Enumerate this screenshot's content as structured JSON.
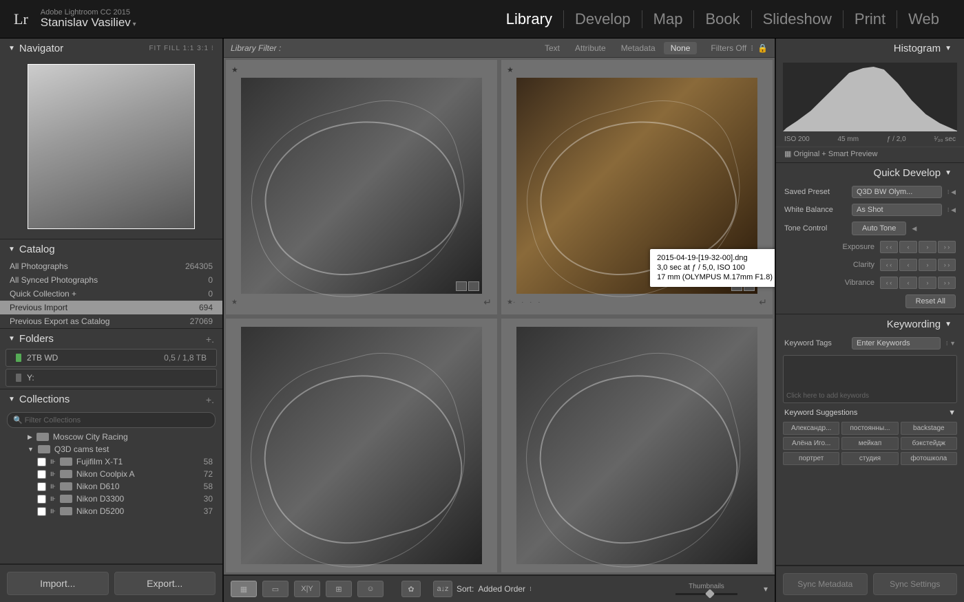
{
  "app_title": "Adobe Lightroom CC 2015",
  "user": "Stanislav Vasiliev",
  "modules": [
    "Library",
    "Develop",
    "Map",
    "Book",
    "Slideshow",
    "Print",
    "Web"
  ],
  "active_module": "Library",
  "navigator": {
    "title": "Navigator",
    "extras": "FIT   FILL   1:1   3:1 ⁝"
  },
  "catalog": {
    "title": "Catalog",
    "items": [
      {
        "label": "All Photographs",
        "count": "264305"
      },
      {
        "label": "All Synced Photographs",
        "count": "0"
      },
      {
        "label": "Quick Collection  +",
        "count": "0"
      },
      {
        "label": "Previous Import",
        "count": "694",
        "sel": true
      },
      {
        "label": "Previous Export as Catalog",
        "count": "27069"
      }
    ]
  },
  "folders": {
    "title": "Folders",
    "items": [
      {
        "label": "2TB WD",
        "count": "0,5 / 1,8 TB",
        "disk": true
      },
      {
        "label": "Y:",
        "count": "",
        "disk": true,
        "dim": true
      }
    ]
  },
  "collections": {
    "title": "Collections",
    "search_ph": "Filter Collections",
    "items": [
      {
        "label": "Moscow City Racing",
        "level": 1,
        "tri": "▶"
      },
      {
        "label": "Q3D cams test",
        "level": 1,
        "tri": "▼",
        "open": true
      },
      {
        "label": "Fujifilm X-T1",
        "count": "58",
        "level": 2,
        "tri": "⊪"
      },
      {
        "label": "Nikon Coolpix A",
        "count": "72",
        "level": 2,
        "tri": "⊪"
      },
      {
        "label": "Nikon D610",
        "count": "58",
        "level": 2,
        "tri": "⊪"
      },
      {
        "label": "Nikon D3300",
        "count": "30",
        "level": 2,
        "tri": "⊪"
      },
      {
        "label": "Nikon D5200",
        "count": "37",
        "level": 2,
        "tri": "⊪"
      }
    ]
  },
  "left_buttons": {
    "import": "Import...",
    "export": "Export..."
  },
  "filterbar": {
    "label": "Library Filter :",
    "opts": [
      "Text",
      "Attribute",
      "Metadata",
      "None"
    ],
    "active": "None",
    "filters_off": "Filters Off"
  },
  "tooltip": {
    "l1": "2015-04-19-[19-32-00].dng",
    "l2": "3,0 sec at ƒ / 5,0, ISO 100",
    "l3": "17 mm (OLYMPUS M.17mm F1.8)"
  },
  "toolbar": {
    "sort_label": "Sort:",
    "sort_value": "Added Order",
    "thumbs": "Thumbnails"
  },
  "histogram": {
    "title": "Histogram",
    "iso": "ISO 200",
    "focal": "45 mm",
    "ap": "ƒ / 2,0",
    "sh": "¹⁄₃₀ sec",
    "status": "▦ Original + Smart Preview"
  },
  "quickdev": {
    "title": "Quick Develop",
    "preset_lbl": "Saved Preset",
    "preset_val": "Q3D BW Olym...",
    "wb_lbl": "White Balance",
    "wb_val": "As Shot",
    "tone_lbl": "Tone Control",
    "auto": "Auto Tone",
    "exposure": "Exposure",
    "clarity": "Clarity",
    "vibrance": "Vibrance",
    "reset": "Reset All"
  },
  "keywording": {
    "title": "Keywording",
    "tags_lbl": "Keyword Tags",
    "tags_val": "Enter Keywords",
    "placeholder": "Click here to add keywords",
    "sug": "Keyword Suggestions",
    "tags": [
      "Александр...",
      "постоянны...",
      "backstage",
      "Алёна Иго...",
      "мейкап",
      "бэкстейдж",
      "портрет",
      "студия",
      "фотошкола"
    ]
  },
  "right_buttons": {
    "sync_meta": "Sync Metadata",
    "sync_set": "Sync Settings"
  }
}
